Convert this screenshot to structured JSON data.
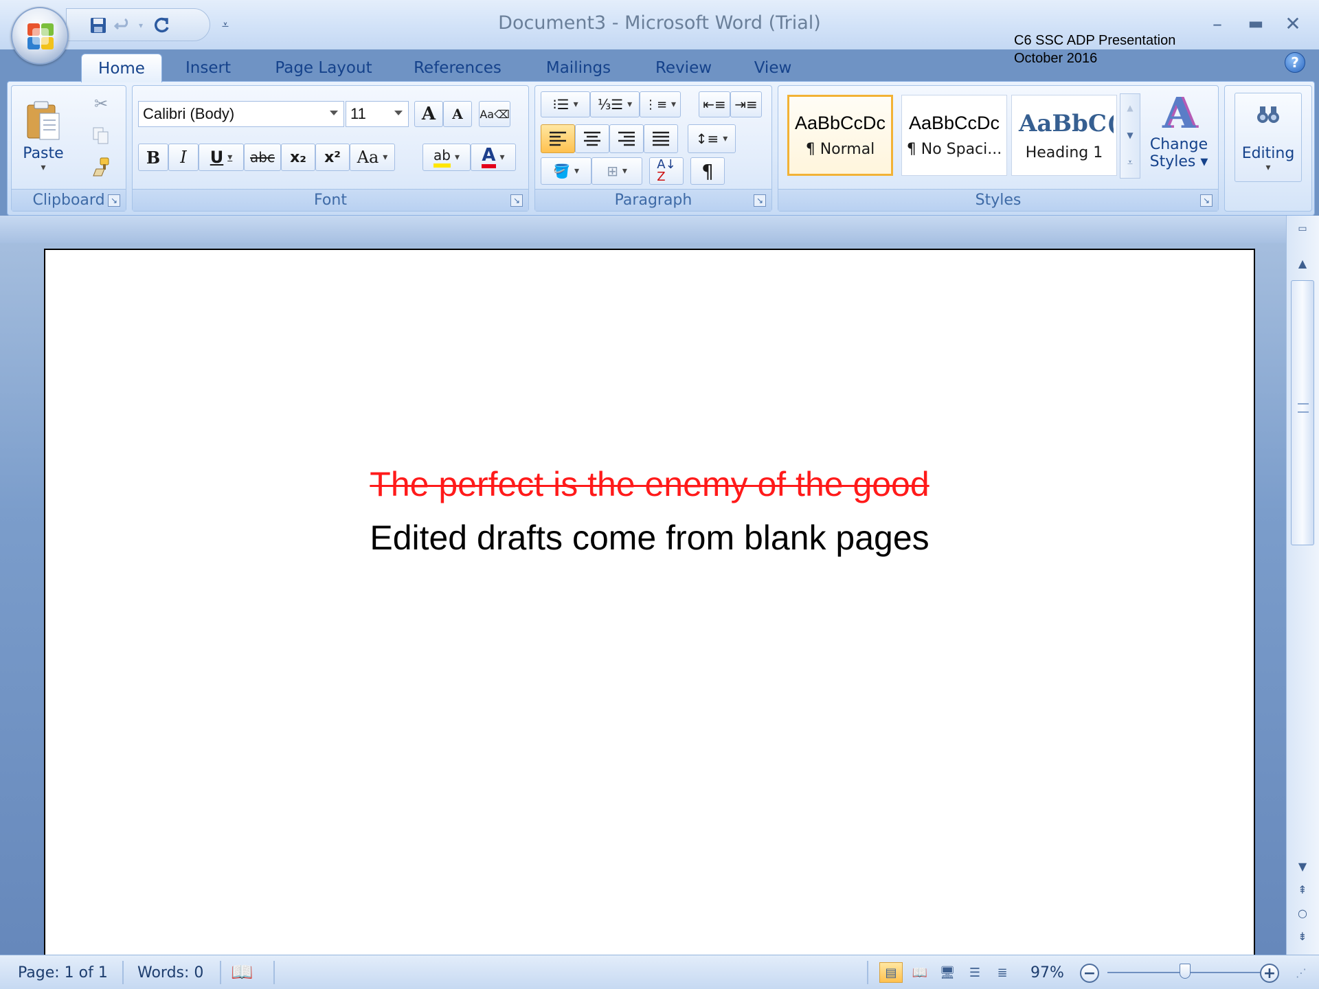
{
  "window": {
    "title": "Document3 - Microsoft Word (Trial)",
    "overlay_line1": "C6 SSC ADP Presentation",
    "overlay_line2": "October 2016"
  },
  "tabs": [
    "Home",
    "Insert",
    "Page Layout",
    "References",
    "Mailings",
    "Review",
    "View"
  ],
  "ribbon": {
    "clipboard": {
      "label": "Clipboard",
      "paste_label": "Paste"
    },
    "font": {
      "label": "Font",
      "font_name": "Calibri (Body)",
      "font_size": "11",
      "bold": "B",
      "italic": "I",
      "underline": "U",
      "strike": "abc",
      "subscript": "x₂",
      "superscript": "x²",
      "change_case": "Aa",
      "grow": "A",
      "shrink": "A",
      "highlight": "ab",
      "font_color": "A"
    },
    "paragraph": {
      "label": "Paragraph",
      "pilcrow": "¶"
    },
    "styles": {
      "label": "Styles",
      "items": [
        {
          "sample": "AaBbCcDc",
          "name": "¶ Normal"
        },
        {
          "sample": "AaBbCcDc",
          "name": "¶ No Spaci..."
        },
        {
          "sample": "AaBbC(",
          "name": "Heading 1"
        }
      ],
      "change_styles_line1": "Change",
      "change_styles_line2": "Styles"
    },
    "editing": {
      "label": "Editing"
    }
  },
  "document": {
    "line_struck": "The perfect is the enemy of the good",
    "line_normal": "Edited drafts come from blank pages",
    "struck_color": "#ff1a1a"
  },
  "status": {
    "page": "Page: 1 of 1",
    "words": "Words: 0",
    "zoom": "97%",
    "zoom_fraction": 0.485
  },
  "icons": [
    "office-orb-icon",
    "save-icon",
    "undo-icon",
    "redo-icon",
    "customize-qat-icon",
    "minimize-icon",
    "maximize-icon",
    "close-icon",
    "help-icon",
    "paste-icon",
    "cut-icon",
    "copy-icon",
    "format-painter-icon",
    "find-icon",
    "proofing-icon"
  ]
}
